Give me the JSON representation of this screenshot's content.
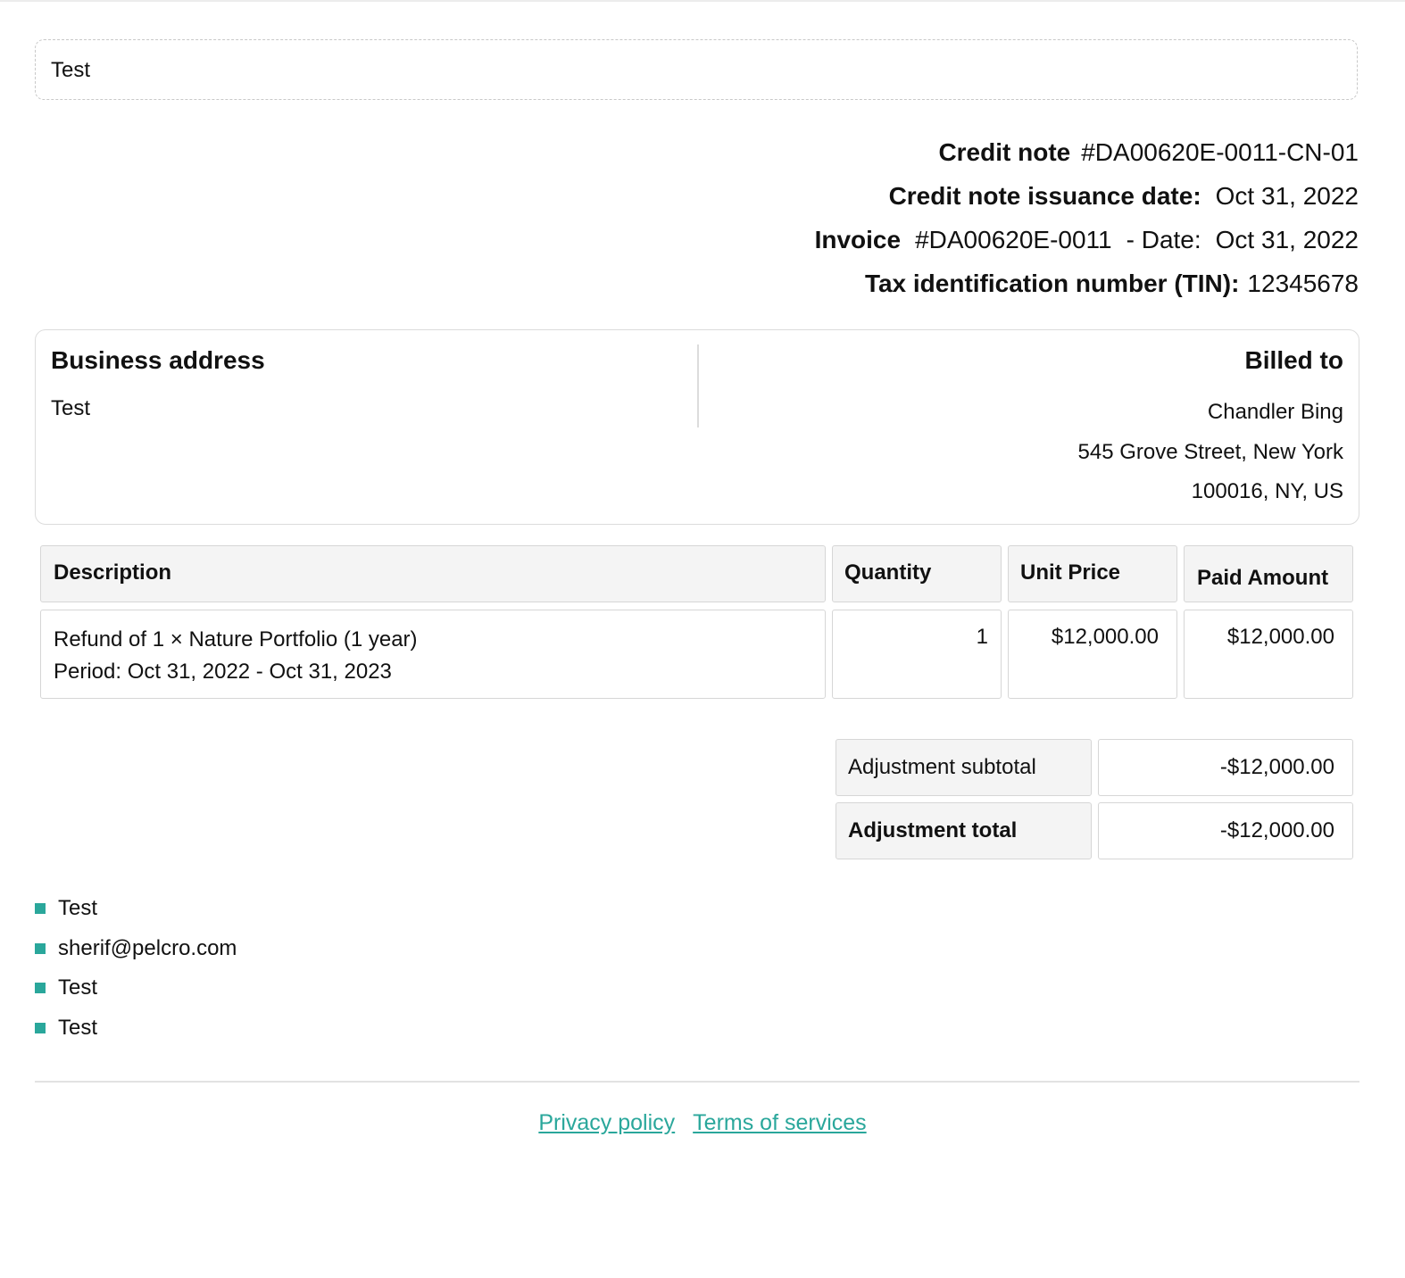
{
  "header": {
    "logo_text": "Test"
  },
  "meta": {
    "credit_note_label": "Credit note",
    "credit_note_number": "#DA00620E-0011-CN-01",
    "issuance_label": "Credit note issuance date:",
    "issuance_date": "Oct 31, 2022",
    "invoice_label": "Invoice",
    "invoice_number": "#DA00620E-0011",
    "invoice_date_label": "- Date:",
    "invoice_date": "Oct 31, 2022",
    "tin_label": "Tax identification number (TIN):",
    "tin_value": "12345678"
  },
  "business": {
    "title": "Business address",
    "lines": [
      "Test"
    ]
  },
  "billed_to": {
    "title": "Billed to",
    "lines": [
      "Chandler Bing",
      "545 Grove Street, New York",
      "100016, NY, US"
    ]
  },
  "table": {
    "headers": {
      "description": "Description",
      "quantity": "Quantity",
      "unit_price": "Unit Price",
      "paid_amount": "Paid Amount"
    },
    "rows": [
      {
        "description_line1": "Refund of 1 × Nature Portfolio (1 year)",
        "description_line2": "Period: Oct 31, 2022 - Oct 31, 2023",
        "quantity": "1",
        "unit_price": "$12,000.00",
        "paid_amount": "$12,000.00"
      }
    ]
  },
  "totals": {
    "subtotal_label": "Adjustment subtotal",
    "subtotal_value": "-$12,000.00",
    "total_label": "Adjustment total",
    "total_value": "-$12,000.00"
  },
  "contact": {
    "items": [
      "Test",
      "sherif@pelcro.com",
      "Test",
      "Test"
    ]
  },
  "footer": {
    "privacy": "Privacy policy",
    "terms": "Terms of services"
  },
  "colors": {
    "accent": "#2aa79b",
    "header_bg": "#f4f4f4",
    "border": "#d6d6d6"
  }
}
